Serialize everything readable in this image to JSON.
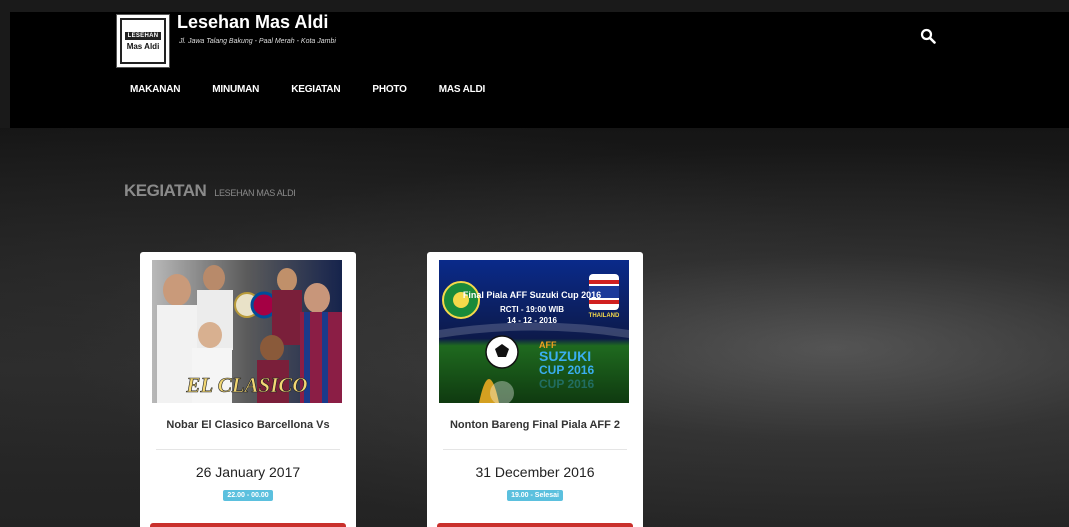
{
  "header": {
    "logo": {
      "top_text": "LESEHAN",
      "bottom_text": "Mas Aldi"
    },
    "title": "Lesehan Mas Aldi",
    "subtitle": "Jl. Jawa Talang Bakung - Paal Merah - Kota Jambi",
    "search_icon": "search-icon"
  },
  "nav": {
    "items": [
      "MAKANAN",
      "MINUMAN",
      "KEGIATAN",
      "PHOTO",
      "MAS ALDI"
    ]
  },
  "page": {
    "heading": "KEGIATAN",
    "subheading": "LESEHAN MAS ALDI"
  },
  "cards": [
    {
      "image_lettering": "EL CLASICO",
      "title": "Nobar El Clasico Barcellona Vs",
      "date": "26 January 2017",
      "time": "22.00 - 00.00"
    },
    {
      "image_lettering": [
        "Final Piala AFF Suzuki Cup 2016",
        "RCTI - 19:00 WIB",
        "14 - 12 - 2016",
        "AFF",
        "SUZUKI",
        "CUP 2016",
        "THAILAND"
      ],
      "title": "Nonton Bareng Final Piala AFF 2",
      "date": "31 December 2016",
      "time": "19.00 - Selesai"
    }
  ],
  "colors": {
    "header_bg": "#000000",
    "time_badge": "#5bc0de",
    "button": "#c9302c"
  }
}
